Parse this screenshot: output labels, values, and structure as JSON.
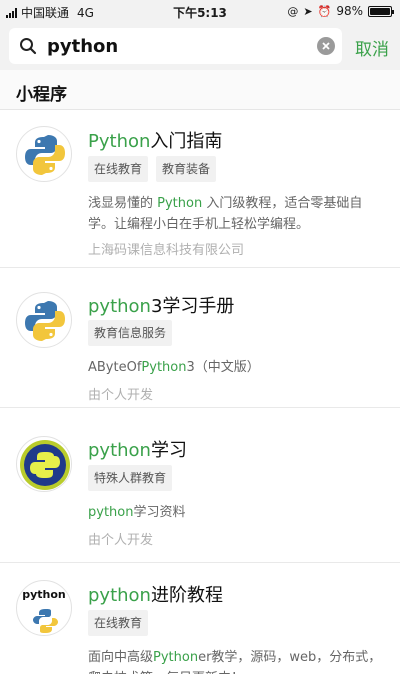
{
  "status_bar": {
    "carrier": "中国联通",
    "network": "4G",
    "time": "下午5:13",
    "battery": "98%",
    "battery_level": 0.98
  },
  "search": {
    "query": "python",
    "cancel_label": "取消"
  },
  "section": {
    "title": "小程序"
  },
  "results": [
    {
      "title_prefix": "",
      "title_highlight": "Python",
      "title_rest": "入门指南",
      "tags": [
        "在线教育",
        "教育装备"
      ],
      "desc_parts": [
        "浅显易懂的 ",
        "Python",
        " 入门级教程，适合零基础自学。让编程小白在手机上轻松学编程。"
      ],
      "owner": "上海码课信息科技有限公司",
      "icon": "python-logo-icon"
    },
    {
      "title_prefix": "",
      "title_highlight": "python",
      "title_rest": "3学习手册",
      "tags": [
        "教育信息服务"
      ],
      "desc_parts": [
        "AByteOf",
        "Python",
        "3（中文版）"
      ],
      "owner": "由个人开发",
      "icon": "python-logo-icon"
    },
    {
      "title_prefix": "",
      "title_highlight": "python",
      "title_rest": "学习",
      "tags": [
        "特殊人群教育"
      ],
      "desc_parts": [
        "",
        "python",
        "学习资料"
      ],
      "owner": "由个人开发",
      "icon": "python-badge-icon"
    },
    {
      "title_prefix": "",
      "title_highlight": "python",
      "title_rest": "进阶教程",
      "tags": [
        "在线教育"
      ],
      "desc_parts": [
        "面向中高级",
        "Python",
        "er教学，源码，web，分布式，爬虫技术等，每日更新中！"
      ],
      "owner": "",
      "icon": "python-text-logo-icon",
      "logo_text": "python"
    }
  ]
}
